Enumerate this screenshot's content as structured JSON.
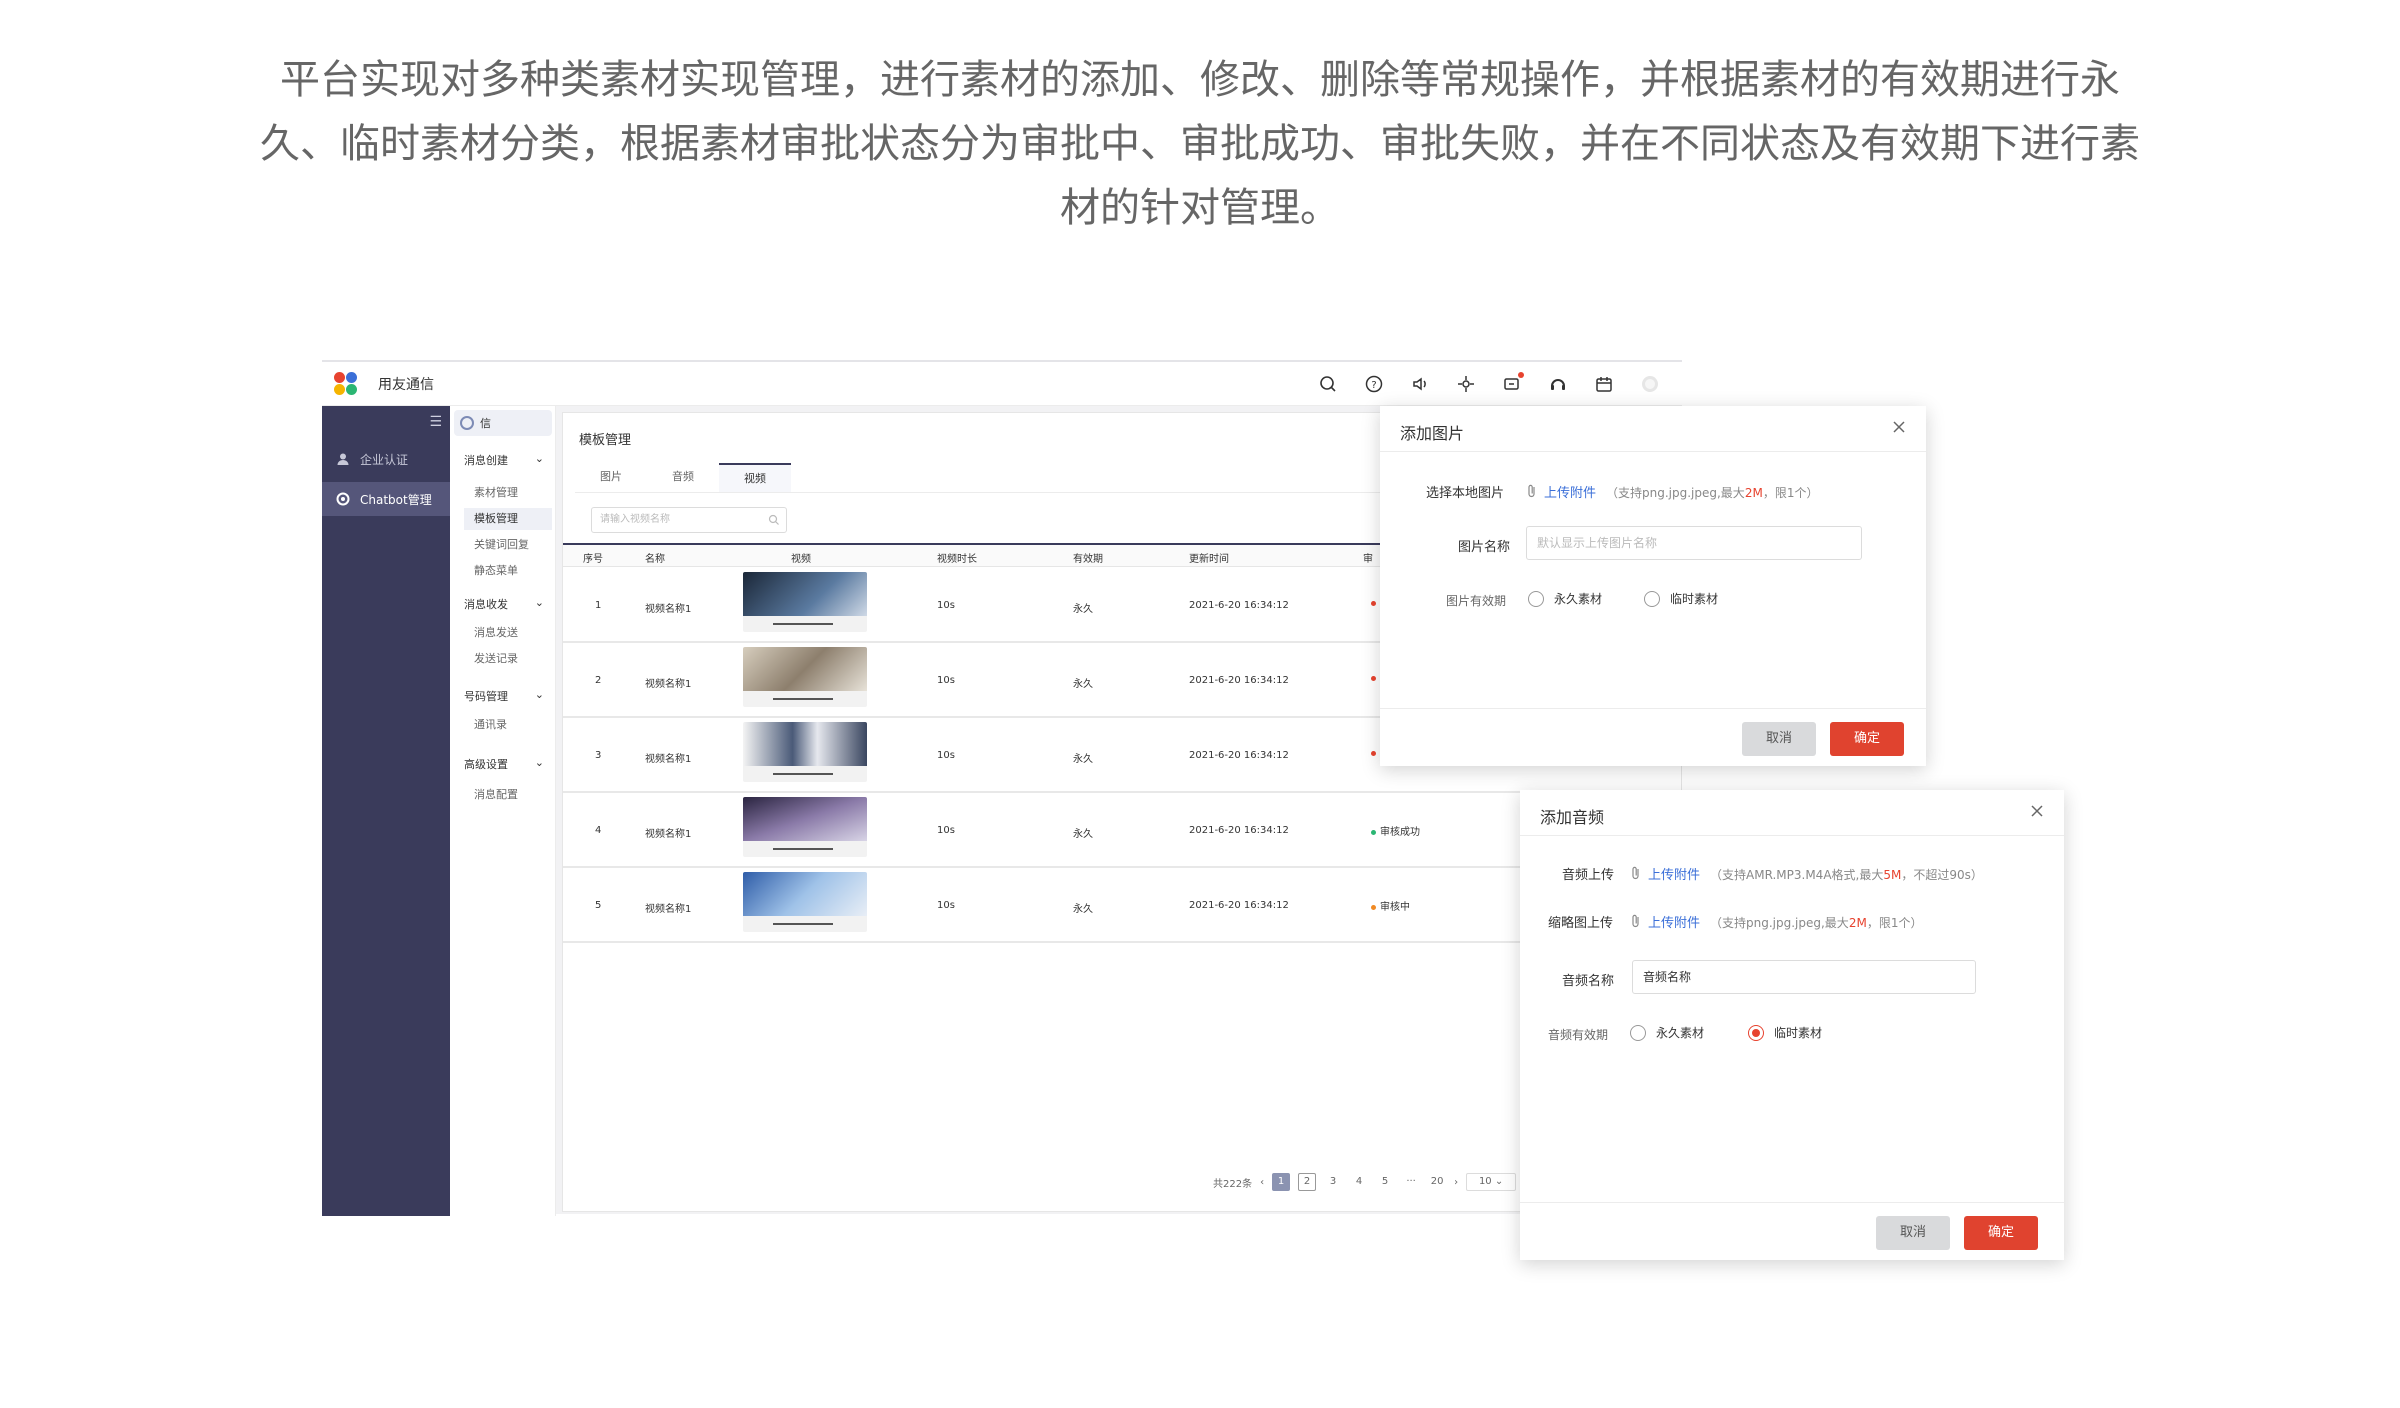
{
  "intro": {
    "line1": "平台实现对多种类素材实现管理，进行素材的添加、修改、删除等常规操作，并根据素材的有效期进行永",
    "line2": "久、临时素材分类，根据素材审批状态分为审批中、审批成功、审批失败，并在不同状态及有效期下进行素",
    "line3": "材的针对管理。"
  },
  "app": {
    "brand": "用友通信",
    "top_icons": [
      "search-icon",
      "help-icon",
      "speaker-icon",
      "plugin-icon",
      "message-icon",
      "headset-icon",
      "calendar-icon",
      "avatar-icon"
    ]
  },
  "sidebar1": {
    "items": [
      {
        "label": "企业认证",
        "icon": "user-icon"
      },
      {
        "label": "Chatbot管理",
        "icon": "bot-icon"
      }
    ]
  },
  "sidebar2": {
    "account": "信",
    "groups": [
      {
        "label": "消息创建",
        "subs": [
          "素材管理",
          "模板管理",
          "关键词回复",
          "静态菜单"
        ]
      },
      {
        "label": "消息收发",
        "subs": [
          "消息发送",
          "发送记录"
        ]
      },
      {
        "label": "号码管理",
        "subs": [
          "通讯录"
        ]
      },
      {
        "label": "高级设置",
        "subs": [
          "消息配置"
        ]
      }
    ]
  },
  "main": {
    "title": "模板管理",
    "tabs": [
      "图片",
      "音频",
      "视频"
    ],
    "active_tab": "视频",
    "search_placeholder": "请输入视频名称",
    "columns": [
      "序号",
      "名称",
      "视频",
      "视频时长",
      "有效期",
      "更新时间",
      "审"
    ],
    "rows": [
      {
        "no": "1",
        "name": "视频名称1",
        "duration": "10s",
        "validity": "永久",
        "updated": "2021-6-20  16:34:12",
        "status": "",
        "status_color": "#e7432f"
      },
      {
        "no": "2",
        "name": "视频名称1",
        "duration": "10s",
        "validity": "永久",
        "updated": "2021-6-20  16:34:12",
        "status": "",
        "status_color": "#e7432f"
      },
      {
        "no": "3",
        "name": "视频名称1",
        "duration": "10s",
        "validity": "永久",
        "updated": "2021-6-20  16:34:12",
        "status": "",
        "status_color": "#e7432f"
      },
      {
        "no": "4",
        "name": "视频名称1",
        "duration": "10s",
        "validity": "永久",
        "updated": "2021-6-20  16:34:12",
        "status": "审核成功",
        "status_color": "#2bb673"
      },
      {
        "no": "5",
        "name": "视频名称1",
        "duration": "10s",
        "validity": "永久",
        "updated": "2021-6-20  16:34:12",
        "status": "审核中",
        "status_color": "#f08a24"
      }
    ],
    "pager": {
      "total": "共222条",
      "pages": [
        "1",
        "2",
        "3",
        "4",
        "5",
        "···",
        "20"
      ],
      "current": "1",
      "size": "10"
    }
  },
  "dialog_image": {
    "title": "添加图片",
    "file_label": "选择本地图片",
    "upload_link": "上传附件",
    "hint_pre": "（支持png.jpg.jpeg,最大",
    "hint_size": "2M",
    "hint_post": "，限1个）",
    "name_label": "图片名称",
    "name_placeholder": "默认显示上传图片名称",
    "validity_label": "图片有效期",
    "options": [
      "永久素材",
      "临时素材"
    ],
    "cancel": "取消",
    "ok": "确定"
  },
  "dialog_audio": {
    "title": "添加音频",
    "audio_label": "音频上传",
    "upload_link": "上传附件",
    "audio_hint_pre": "（支持AMR.MP3.M4A格式,最大",
    "audio_hint_size": "5M",
    "audio_hint_post": "，不超过90s）",
    "thumb_label": "缩略图上传",
    "thumb_link": "上传附件",
    "thumb_hint_pre": "（支持png.jpg.jpeg,最大",
    "thumb_hint_size": "2M",
    "thumb_hint_post": "，限1个）",
    "name_label": "音频名称",
    "name_value": "音频名称",
    "validity_label": "音频有效期",
    "options": [
      "永久素材",
      "临时素材"
    ],
    "selected": "临时素材",
    "cancel": "取消",
    "ok": "确定"
  }
}
